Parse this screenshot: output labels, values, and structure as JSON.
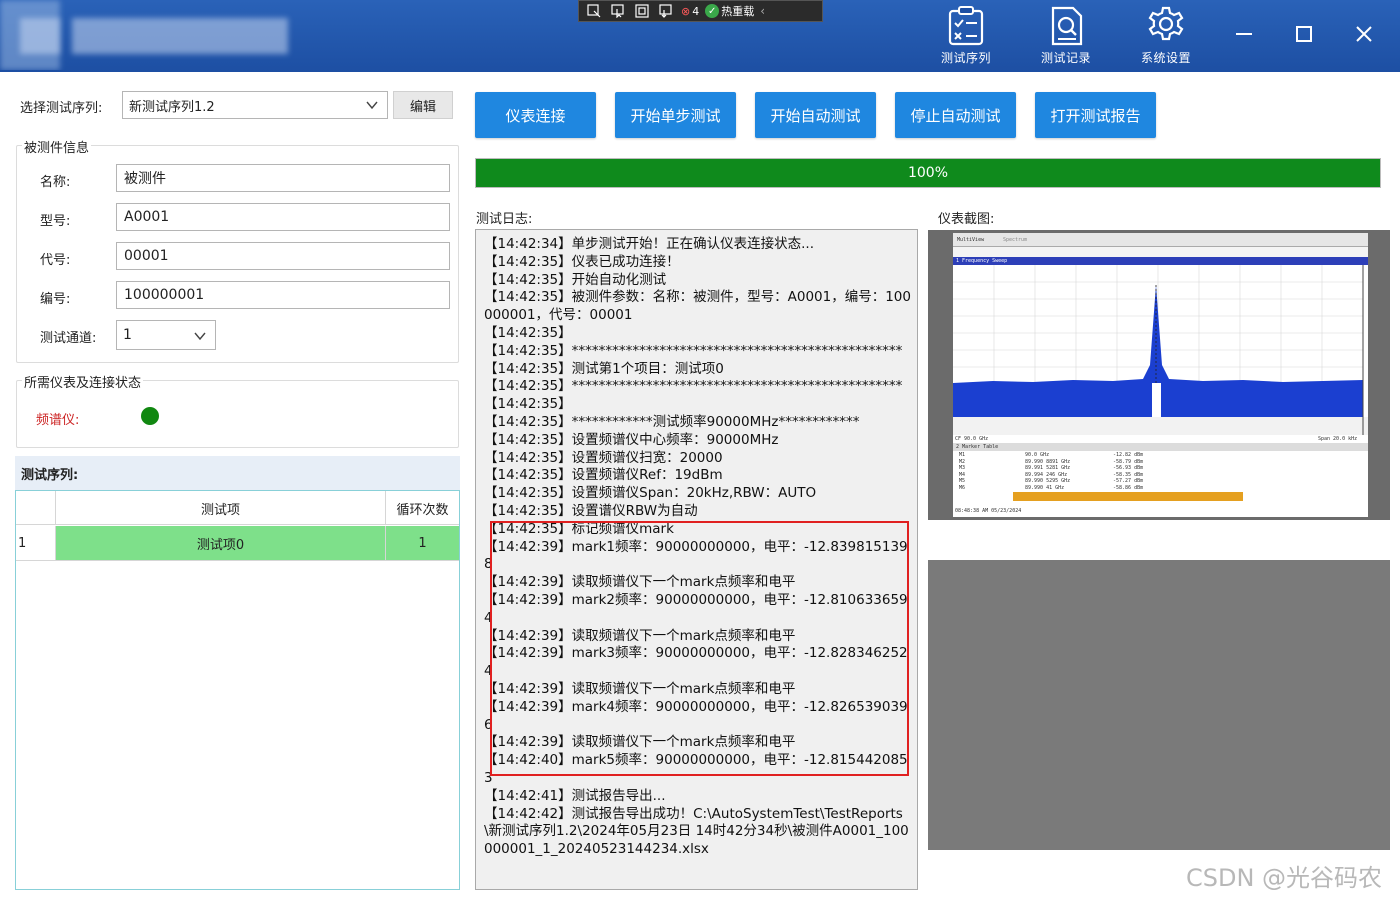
{
  "header": {
    "toolbar_strip": {
      "badge_count": "4",
      "hot_reload": "热重载"
    },
    "nav": [
      {
        "label": "测试序列",
        "icon": "checklist-icon"
      },
      {
        "label": "测试记录",
        "icon": "record-search-icon"
      },
      {
        "label": "系统设置",
        "icon": "gear-icon"
      }
    ]
  },
  "sequence": {
    "select_label": "选择测试序列:",
    "selected": "新测试序列1.2",
    "edit_label": "编辑"
  },
  "dut": {
    "title": "被测件信息",
    "fields": [
      {
        "label": "名称:",
        "value": "被测件"
      },
      {
        "label": "型号:",
        "value": "A0001"
      },
      {
        "label": "代号:",
        "value": "00001"
      },
      {
        "label": "编号:",
        "value": "100000001"
      }
    ],
    "channel_label": "测试通道:",
    "channel_value": "1"
  },
  "instruments": {
    "title": "所需仪表及连接状态",
    "spectrum_label": "频谱仪:",
    "spectrum_status_color": "#118811"
  },
  "seq_table": {
    "title": "测试序列:",
    "headers": [
      "测试项",
      "循环次数"
    ],
    "rows": [
      {
        "index": "1",
        "item": "测试项0",
        "loops": "1"
      }
    ]
  },
  "actions": [
    "仪表连接",
    "开始单步测试",
    "开始自动测试",
    "停止自动测试",
    "打开测试报告"
  ],
  "progress": {
    "value": 1.0,
    "label": "100%",
    "color": "#0f8a1c"
  },
  "log": {
    "label": "测试日志:",
    "lines": [
      "【14:42:34】单步测试开始！正在确认仪表连接状态...",
      "【14:42:35】仪表已成功连接！",
      "【14:42:35】开始自动化测试",
      "【14:42:35】被测件参数：名称：被测件，型号：A0001，编号：100000001，代号：00001",
      "【14:42:35】",
      "【14:42:35】*************************************************",
      "【14:42:35】测试第1个项目：测试项0",
      "【14:42:35】*************************************************",
      "【14:42:35】",
      "【14:42:35】************测试频率90000MHz************",
      "【14:42:35】设置频谱仪中心频率：90000MHz",
      "【14:42:35】设置频谱仪扫宽：20000",
      "【14:42:35】设置频谱仪Ref：19dBm",
      "【14:42:35】设置频谱仪Span：20kHz,RBW：AUTO",
      "【14:42:35】设置谱仪RBW为自动",
      "【14:42:35】标记频谱仪mark",
      "【14:42:39】mark1频率：90000000000，电平：-12.8398151398",
      "【14:42:39】读取频谱仪下一个mark点频率和电平",
      "【14:42:39】mark2频率：90000000000，电平：-12.8106336594",
      "【14:42:39】读取频谱仪下一个mark点频率和电平",
      "【14:42:39】mark3频率：90000000000，电平：-12.8283462524",
      "【14:42:39】读取频谱仪下一个mark点频率和电平",
      "【14:42:39】mark4频率：90000000000，电平：-12.8265390396",
      "【14:42:39】读取频谱仪下一个mark点频率和电平",
      "【14:42:40】mark5频率：90000000000，电平：-12.8154420853",
      "【14:42:41】测试报告导出...",
      "【14:42:42】测试报告导出成功！C:\\AutoSystemTest\\TestReports\\新测试序列1.2\\2024年05月23日 14时42分34秒\\被测件A0001_100000001_1_20240523144234.xlsx"
    ]
  },
  "screenshot": {
    "label": "仪表截图:",
    "analyzer": {
      "tabs": [
        "MultiView",
        "Spectrum"
      ],
      "trace_title": "1 Frequency Sweep",
      "center": "CF 90.0 GHz",
      "span": "Span 20.0 kHz",
      "marker_table_title": "2 Marker Table",
      "markers": [
        {
          "type": "M1",
          "x": "90.0 GHz",
          "y": "-12.82 dBm"
        },
        {
          "type": "M2",
          "x": "89.990 8891 GHz",
          "y": "-58.79 dBm"
        },
        {
          "type": "M3",
          "x": "89.991 5281 GHz",
          "y": "-56.93 dBm"
        },
        {
          "type": "M4",
          "x": "89.994 246 GHz",
          "y": "-58.35 dBm"
        },
        {
          "type": "M5",
          "x": "89.990 5295 GHz",
          "y": "-57.27 dBm"
        },
        {
          "type": "M6",
          "x": "89.990 41 GHz",
          "y": "-58.86 dBm"
        }
      ],
      "timestamp": "08:48:38 AM 05/23/2024"
    }
  },
  "watermark": "CSDN @光谷码农"
}
